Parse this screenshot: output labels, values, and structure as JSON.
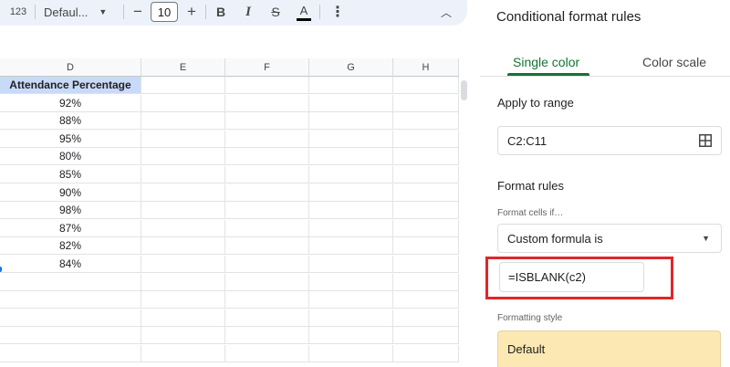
{
  "toolbar": {
    "number_format_label": "123",
    "font_name": "Defaul...",
    "font_caret": "▼",
    "decrease_size": "−",
    "font_size": "10",
    "increase_size": "+",
    "bold_label": "B",
    "italic_label": "I",
    "strikethrough_label": "S",
    "text_color_label": "A",
    "more_label": "⋮",
    "collapse_label": "︿"
  },
  "sheet": {
    "columns": [
      "D",
      "E",
      "F",
      "G",
      "H"
    ],
    "header_cell": "Attendance Percentage",
    "header_bg": "#c9daf8",
    "attendance": [
      "92%",
      "88%",
      "95%",
      "80%",
      "85%",
      "90%",
      "98%",
      "87%",
      "82%",
      "84%"
    ]
  },
  "panel": {
    "title": "Conditional format rules",
    "tabs": [
      "Single color",
      "Color scale"
    ],
    "active_tab": "Single color",
    "accent_color": "#137333",
    "apply_to_range_label": "Apply to range",
    "range_value": "C2:C11",
    "format_rules_label": "Format rules",
    "format_cells_if_label": "Format cells if…",
    "condition_value": "Custom formula is",
    "condition_caret": "▼",
    "formula_value": "=ISBLANK(c2)",
    "highlight_color": "#e0262b",
    "formatting_style_label": "Formatting style",
    "style_value": "Default",
    "style_bg": "#fce8b2",
    "range_icon": "grid-select-icon"
  }
}
